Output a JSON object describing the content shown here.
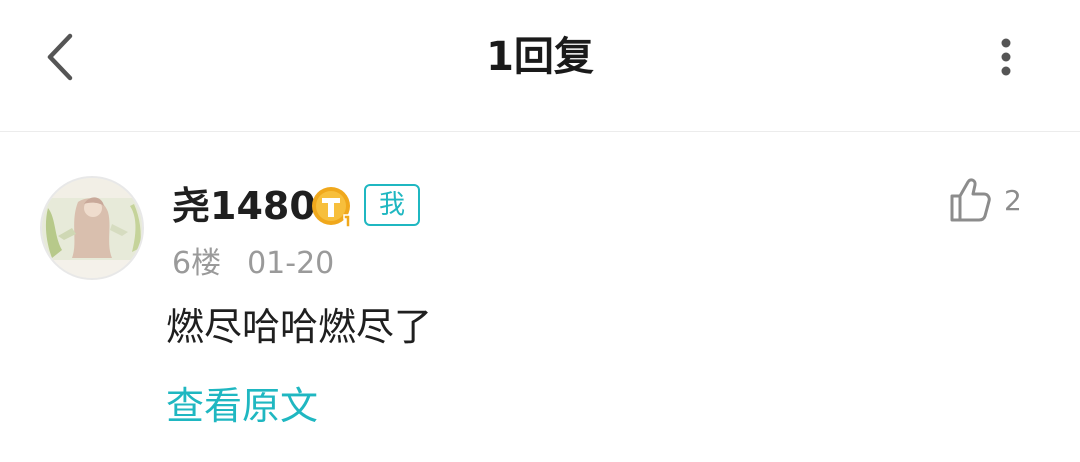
{
  "header": {
    "title": "1回复"
  },
  "reply": {
    "username": "尧1480",
    "me_tag": "我",
    "floor": "6楼",
    "date": "01-20",
    "like_count": "2",
    "content": "燃尽哈哈燃尽了",
    "view_original": "查看原文"
  },
  "colors": {
    "accent": "#1fb7c1",
    "level_badge": "#f0a81c",
    "meta_text": "#9a9a9a"
  },
  "icons": {
    "back": "chevron-left-icon",
    "more": "vertical-dots-icon",
    "like": "thumbs-up-icon",
    "level": "level-badge-icon"
  }
}
